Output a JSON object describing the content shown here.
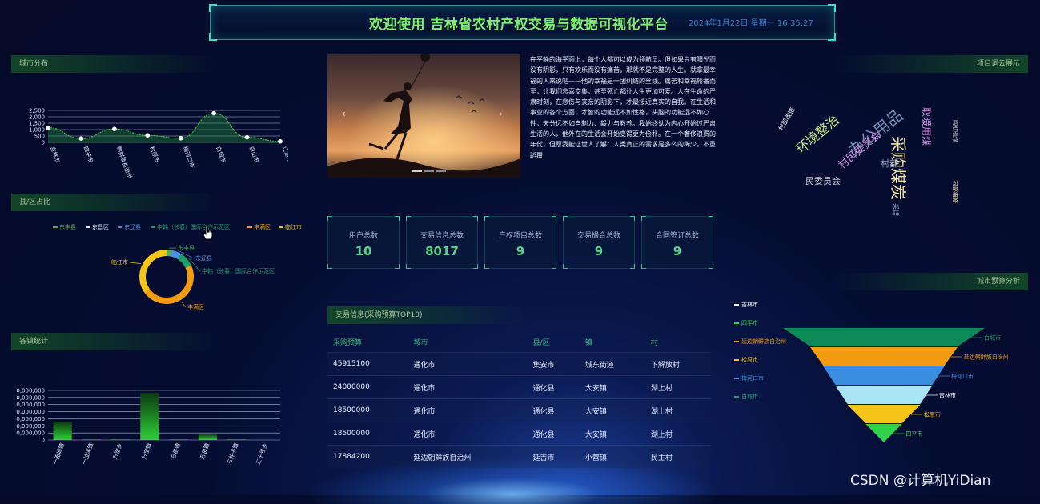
{
  "header": {
    "title": "欢迎使用 吉林省农村产权交易与数据可视化平台",
    "datetime": "2024年1月22日 星期一 16:35:27"
  },
  "colors": {
    "accent": "#7cf06a",
    "panel_title": "#a9c79a",
    "stat_value": "#58d38a"
  },
  "panels": {
    "city_distribution": "城市分布",
    "county_share": "县/区占比",
    "town_stats": "各镇统计",
    "wordcloud": "项目词云展示",
    "city_budget": "城市预算分析",
    "trade_info": "交易信息(采购预算TOP10)"
  },
  "city_chart": {
    "yticks": [
      "2,500",
      "2,000",
      "1,500",
      "1,000",
      "500",
      "0"
    ],
    "chart_data": {
      "type": "line",
      "categories": [
        "吉林市",
        "四平市",
        "朝鲜族自治州",
        "松原市",
        "梅河口市",
        "白城市",
        "白山市",
        "辽源市"
      ],
      "values": [
        1150,
        300,
        1050,
        550,
        330,
        2280,
        400,
        80
      ],
      "ylim": [
        0,
        2500
      ]
    }
  },
  "county_chart": {
    "legend": [
      {
        "name": "东丰县",
        "color": "#4cb050"
      },
      {
        "name": "东昌区",
        "color": "#dfe8ff"
      },
      {
        "name": "东辽县",
        "color": "#4a90e2"
      },
      {
        "name": "中韩（长春）国际合作示范区",
        "color": "#1e9e6a"
      },
      {
        "name": "丰满区",
        "color": "#f39c12"
      },
      {
        "name": "临江市",
        "color": "#f5c518"
      }
    ],
    "chart_data": {
      "type": "pie",
      "categories": [
        "东丰县",
        "东辽县",
        "中韩（长春）国际合作示范区",
        "丰满区",
        "临江市"
      ],
      "values": [
        3,
        6,
        9,
        47,
        35
      ]
    },
    "labels": [
      "东丰县",
      "东辽县",
      "中韩（长春）国际合作示范区",
      "丰满区",
      "临江市"
    ]
  },
  "town_chart": {
    "yticks": [
      "0,000,000",
      "0,000,000",
      "0,000,000",
      "0,000,000",
      "0,000,000",
      "0,000,000",
      "0,000,000",
      "0"
    ],
    "chart_data": {
      "type": "bar",
      "categories": [
        "一面城镇",
        "一拉溪镇",
        "万宝乡",
        "万宝镇",
        "万昌镇",
        "万良镇",
        "三井子镇",
        "三十号乡"
      ],
      "values": [
        22,
        1,
        1,
        57,
        1,
        7,
        1,
        0
      ],
      "ylim": [
        0,
        60
      ]
    }
  },
  "carousel": {
    "prev": "‹",
    "next": "›"
  },
  "article": {
    "text": "在平静的海平面上，每个人都可以成为领航员。但如果只有阳光而没有阴影，只有欢乐而没有痛苦，那就不是完整的人生。就拿最幸福的人来说吧——他的幸福是一团纠结的丝线。痛苦和幸福轮番而至，让我们悲喜交集，甚至死亡都让人生更加可爱。人在生命的严肃时刻，在悲伤与丧亲的阴影下，才最接近真实的自我。在生活和事业的各个方面，才智的功能远不如性格，头脑的功能远不如心性，天分远不如自制力、毅力与教养。我始终认为内心开始过严肃生活的人，他外在的生活会开始变得更为俭朴。在一个奢侈浪费的年代，但愿我能让世人了解：人类真正的需求是多么的稀少。不重蹈覆"
  },
  "stats": [
    {
      "label": "用户总数",
      "value": "10"
    },
    {
      "label": "交易信息总数",
      "value": "8017"
    },
    {
      "label": "产权项目总数",
      "value": "9"
    },
    {
      "label": "交易撮合总数",
      "value": "9"
    },
    {
      "label": "合同签订总数",
      "value": "9"
    }
  ],
  "table": {
    "headers": [
      "采购预算",
      "城市",
      "县/区",
      "镇",
      "村"
    ],
    "rows": [
      [
        "45915100",
        "通化市",
        "集安市",
        "城东街道",
        "下解放村"
      ],
      [
        "24000000",
        "通化市",
        "通化县",
        "大安镇",
        "湖上村"
      ],
      [
        "18500000",
        "通化市",
        "通化县",
        "大安镇",
        "湖上村"
      ],
      [
        "18500000",
        "通化市",
        "通化县",
        "大安镇",
        "湖上村"
      ],
      [
        "17884200",
        "延边朝鲜族自治州",
        "延吉市",
        "小营镇",
        "民主村"
      ]
    ]
  },
  "wordcloud": {
    "words": [
      {
        "text": "采购煤炭",
        "color": "#f5e6a8"
      },
      {
        "text": "办公用品",
        "color": "#6f8fb8"
      },
      {
        "text": "环境整治",
        "color": "#c8e68a"
      },
      {
        "text": "村民委员会",
        "color": "#d78ee0"
      },
      {
        "text": "取暖用煤",
        "color": "#d78ee0"
      },
      {
        "text": "民委员会",
        "color": "#c9c9c9"
      },
      {
        "text": "村部",
        "color": "#8fa3bf"
      },
      {
        "text": "村部改造",
        "color": "#ffffff"
      },
      {
        "text": "采煤",
        "color": "#8fa3bf"
      },
      {
        "text": "村部维修",
        "color": "#f5e6a8"
      },
      {
        "text": "购取暖煤",
        "color": "#c9c9c9"
      }
    ]
  },
  "funnel": {
    "legend": [
      {
        "name": "吉林市",
        "color": "#ffffff"
      },
      {
        "name": "四平市",
        "color": "#2fd24a"
      },
      {
        "name": "延边朝鲜族自治州",
        "color": "#f39c12"
      },
      {
        "name": "松原市",
        "color": "#f5c518"
      },
      {
        "name": "梅河口市",
        "color": "#4a90e2"
      },
      {
        "name": "白城市",
        "color": "#1e9e6a"
      }
    ],
    "chart_data": {
      "type": "funnel",
      "categories": [
        "白城市",
        "延边朝鲜族自治州",
        "梅河口市",
        "吉林市",
        "松原市",
        "四平市"
      ],
      "values": [
        100,
        73,
        60,
        48,
        36,
        18
      ]
    }
  },
  "watermark": "CSDN @计算机YiDian"
}
